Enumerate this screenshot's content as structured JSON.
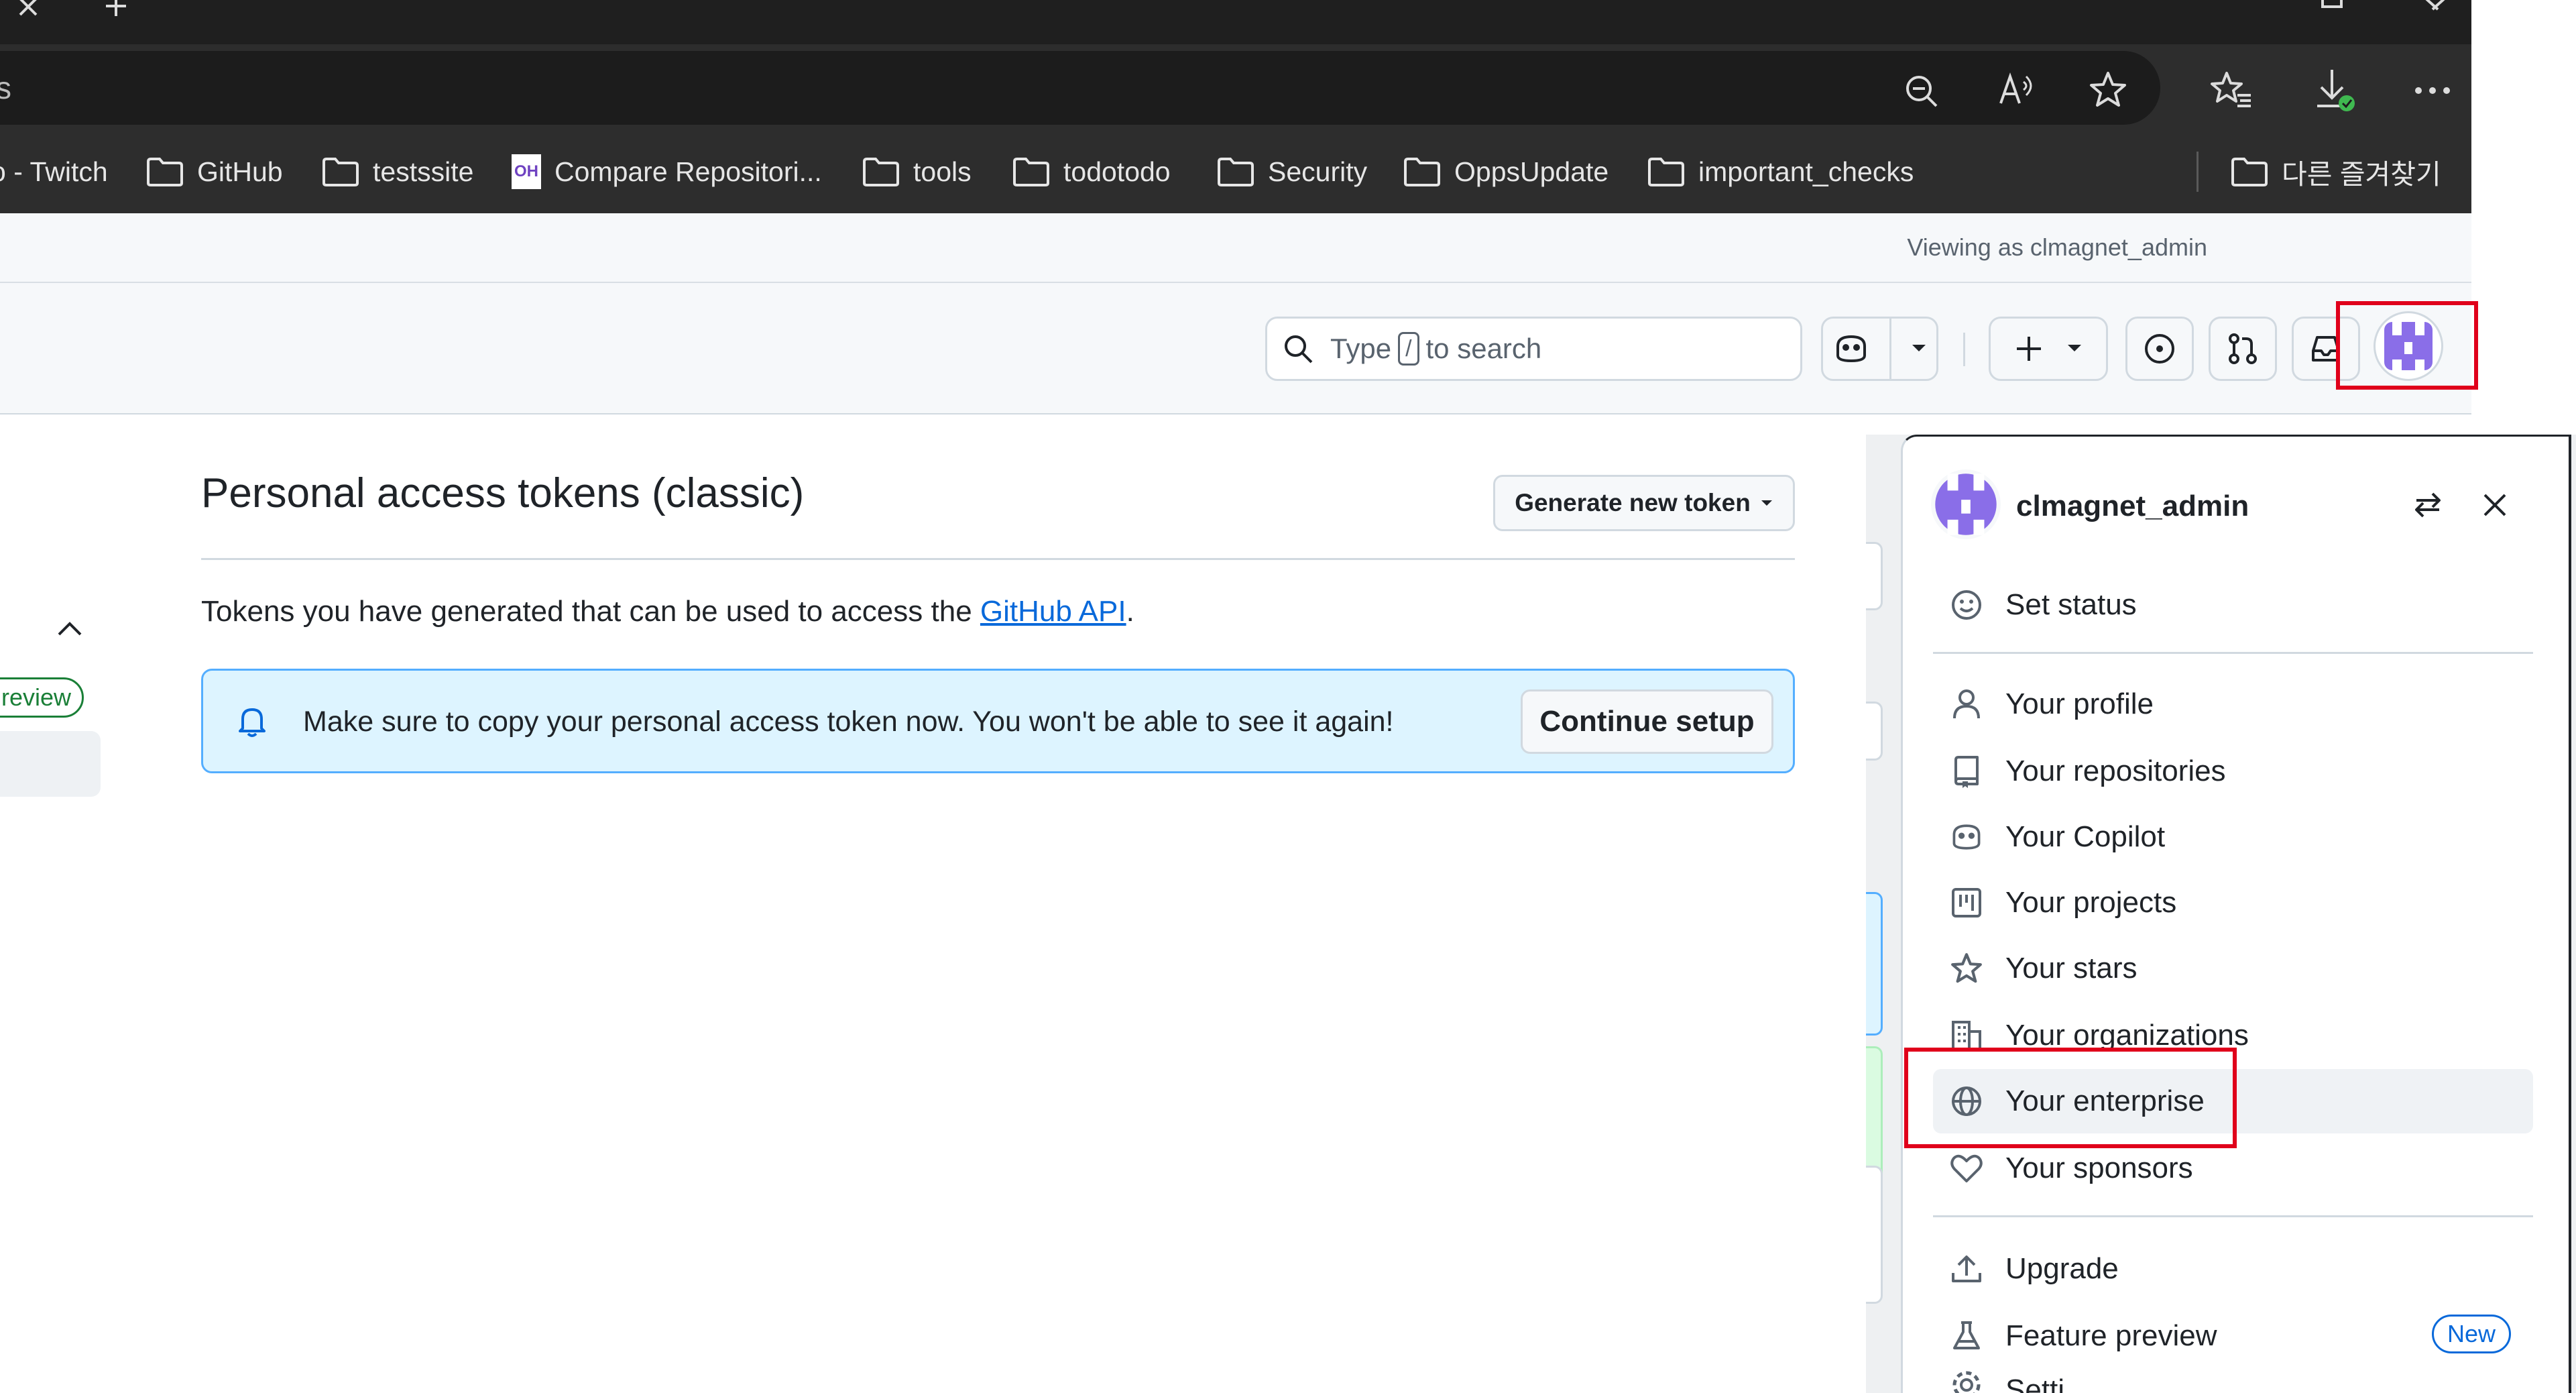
{
  "browser": {
    "address_fragment": "s",
    "bookmarks": [
      {
        "label": "o - Twitch",
        "icon": "none"
      },
      {
        "label": "GitHub",
        "icon": "folder-icon"
      },
      {
        "label": "testssite",
        "icon": "folder-icon"
      },
      {
        "label": "Compare Repositori...",
        "icon": "oh-site-icon"
      },
      {
        "label": "tools",
        "icon": "folder-icon"
      },
      {
        "label": "todotodo",
        "icon": "folder-icon"
      },
      {
        "label": "Security",
        "icon": "folder-icon"
      },
      {
        "label": "OppsUpdate",
        "icon": "folder-icon"
      },
      {
        "label": "important_checks",
        "icon": "folder-icon"
      },
      {
        "label": "다른 즐겨찾기",
        "icon": "folder-icon"
      }
    ],
    "oh_badge": "OH"
  },
  "banner": {
    "viewing_as": "Viewing as clmagnet_admin"
  },
  "header": {
    "search_prefix": "Type",
    "search_key": "/",
    "search_suffix": "to search"
  },
  "main": {
    "title": "Personal access tokens (classic)",
    "generate_button": "Generate new token",
    "description_prefix": "Tokens you have generated that can be used to access the ",
    "description_link": "GitHub API",
    "description_suffix": ".",
    "flash_message": "Make sure to copy your personal access token now. You won't be able to see it again!",
    "continue_button": "Continue setup"
  },
  "sidebar": {
    "preview_badge": "review"
  },
  "menu": {
    "username": "clmagnet_admin",
    "set_status": "Set status",
    "items": [
      {
        "label": "Your profile",
        "icon": "person-icon"
      },
      {
        "label": "Your repositories",
        "icon": "repo-icon"
      },
      {
        "label": "Your Copilot",
        "icon": "copilot-icon"
      },
      {
        "label": "Your projects",
        "icon": "project-icon"
      },
      {
        "label": "Your stars",
        "icon": "star-icon"
      },
      {
        "label": "Your organizations",
        "icon": "organization-icon"
      },
      {
        "label": "Your enterprise",
        "icon": "globe-icon"
      },
      {
        "label": "Your sponsors",
        "icon": "heart-icon"
      }
    ],
    "upgrade": "Upgrade",
    "feature_preview": "Feature preview",
    "new_badge": "New",
    "settings_partial": "Setti"
  },
  "colors": {
    "highlight_red": "#e0001b",
    "link_blue": "#0969da",
    "flash_bg": "#ddf4ff",
    "avatar_purple": "#8a6ee8"
  }
}
